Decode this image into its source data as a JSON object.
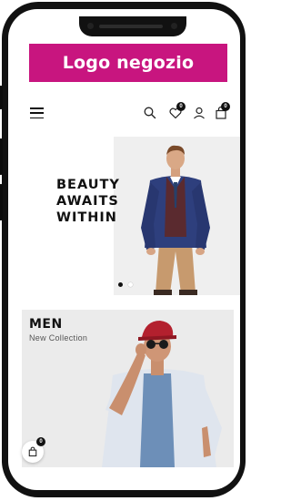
{
  "logo": {
    "text": "Logo negozio",
    "color": "#c8157f"
  },
  "header": {
    "wishlist_count": "0",
    "cart_count": "0",
    "icons": [
      "menu-icon",
      "search-icon",
      "heart-icon",
      "user-icon",
      "bag-icon"
    ]
  },
  "hero": {
    "title_line1": "BEAUTY",
    "title_line2": "AWAITS",
    "title_line3": "WITHIN",
    "slides": 2,
    "active_slide": 1
  },
  "banner_men": {
    "title": "MEN",
    "subtitle": "New Collection"
  },
  "floating_cart": {
    "count": "0"
  }
}
